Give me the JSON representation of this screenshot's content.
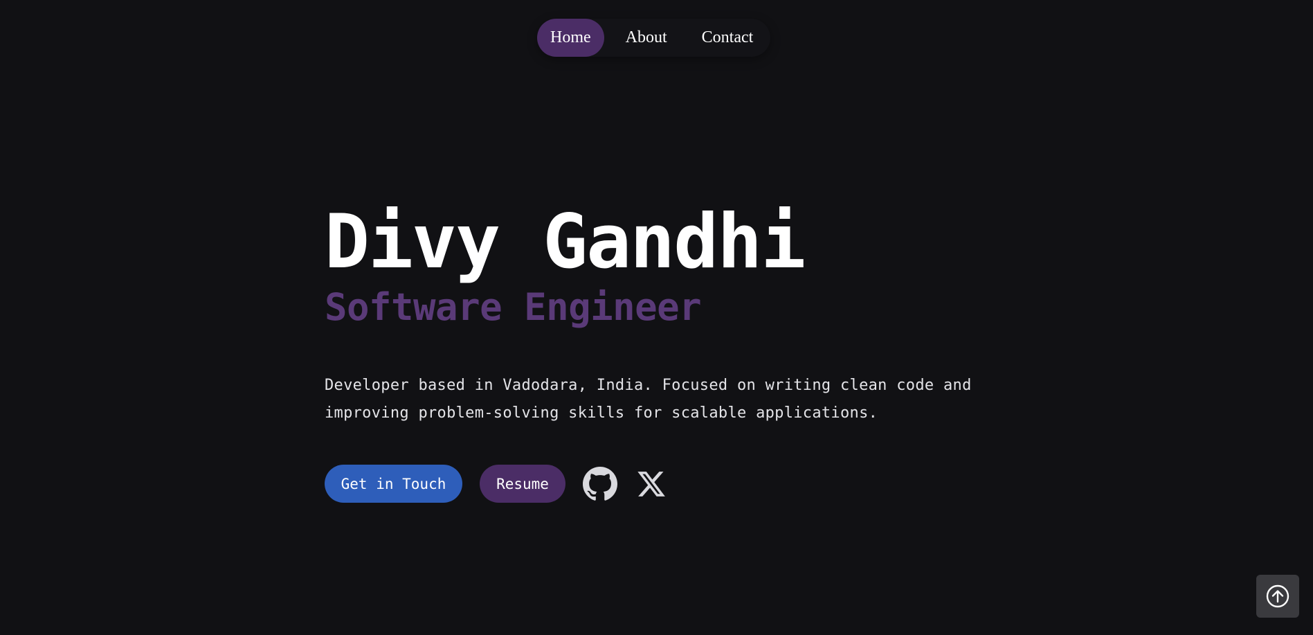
{
  "nav": {
    "items": [
      {
        "label": "Home",
        "active": true
      },
      {
        "label": "About",
        "active": false
      },
      {
        "label": "Contact",
        "active": false
      }
    ]
  },
  "hero": {
    "name": "Divy Gandhi",
    "role": "Software Engineer",
    "description": "Developer based in Vadodara, India. Focused on writing clean code and improving problem-solving skills for scalable applications."
  },
  "actions": {
    "primary_label": "Get in Touch",
    "secondary_label": "Resume",
    "social_icons": [
      "github-icon",
      "x-icon"
    ]
  },
  "scroll_top": {
    "icon": "arrow-up-circle-icon"
  },
  "colors": {
    "background": "#111114",
    "accent_purple": "#4b2d66",
    "role_purple": "#5a3a78",
    "primary_blue": "#2e5eba"
  }
}
